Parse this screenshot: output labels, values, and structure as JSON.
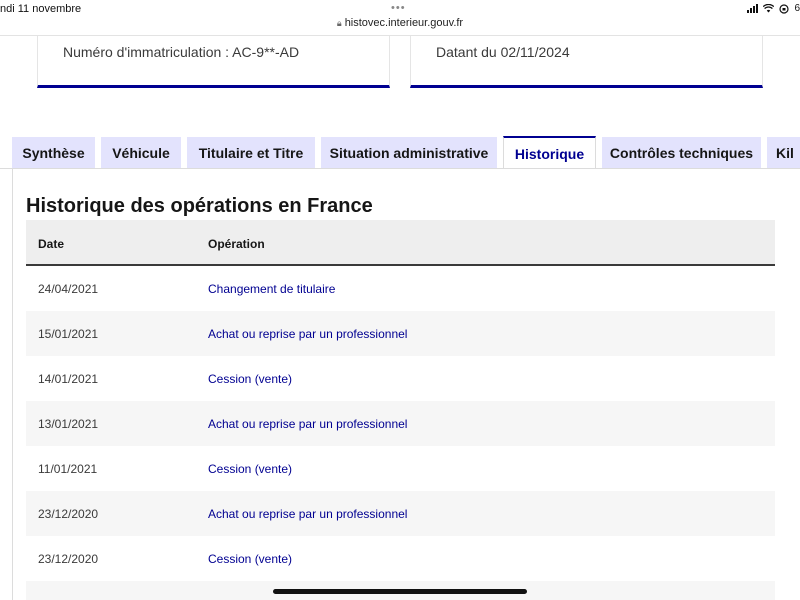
{
  "status_bar": {
    "date": "ndi 11 novembre",
    "url": "histovec.interieur.gouv.fr",
    "battery": "6"
  },
  "cards": {
    "registration": "Numéro d'immatriculation : AC-9**-AD",
    "dated": "Datant du 02/11/2024"
  },
  "tabs": [
    {
      "label": "Synthèse",
      "active": false
    },
    {
      "label": "Véhicule",
      "active": false
    },
    {
      "label": "Titulaire et Titre",
      "active": false
    },
    {
      "label": "Situation administrative",
      "active": false
    },
    {
      "label": "Historique",
      "active": true
    },
    {
      "label": "Contrôles techniques",
      "active": false
    },
    {
      "label": "Kil",
      "active": false
    }
  ],
  "history": {
    "title": "Historique des opérations en France",
    "columns": [
      "Date",
      "Opération"
    ],
    "rows": [
      {
        "date": "24/04/2021",
        "operation": "Changement de titulaire"
      },
      {
        "date": "15/01/2021",
        "operation": "Achat ou reprise par un professionnel"
      },
      {
        "date": "14/01/2021",
        "operation": "Cession (vente)"
      },
      {
        "date": "13/01/2021",
        "operation": "Achat ou reprise par un professionnel"
      },
      {
        "date": "11/01/2021",
        "operation": "Cession (vente)"
      },
      {
        "date": "23/12/2020",
        "operation": "Achat ou reprise par un professionnel"
      },
      {
        "date": "23/12/2020",
        "operation": "Cession (vente)"
      }
    ]
  },
  "colors": {
    "accent": "#000091",
    "tab_bg": "#e3e3fd",
    "row_alt": "#f6f6f6"
  }
}
